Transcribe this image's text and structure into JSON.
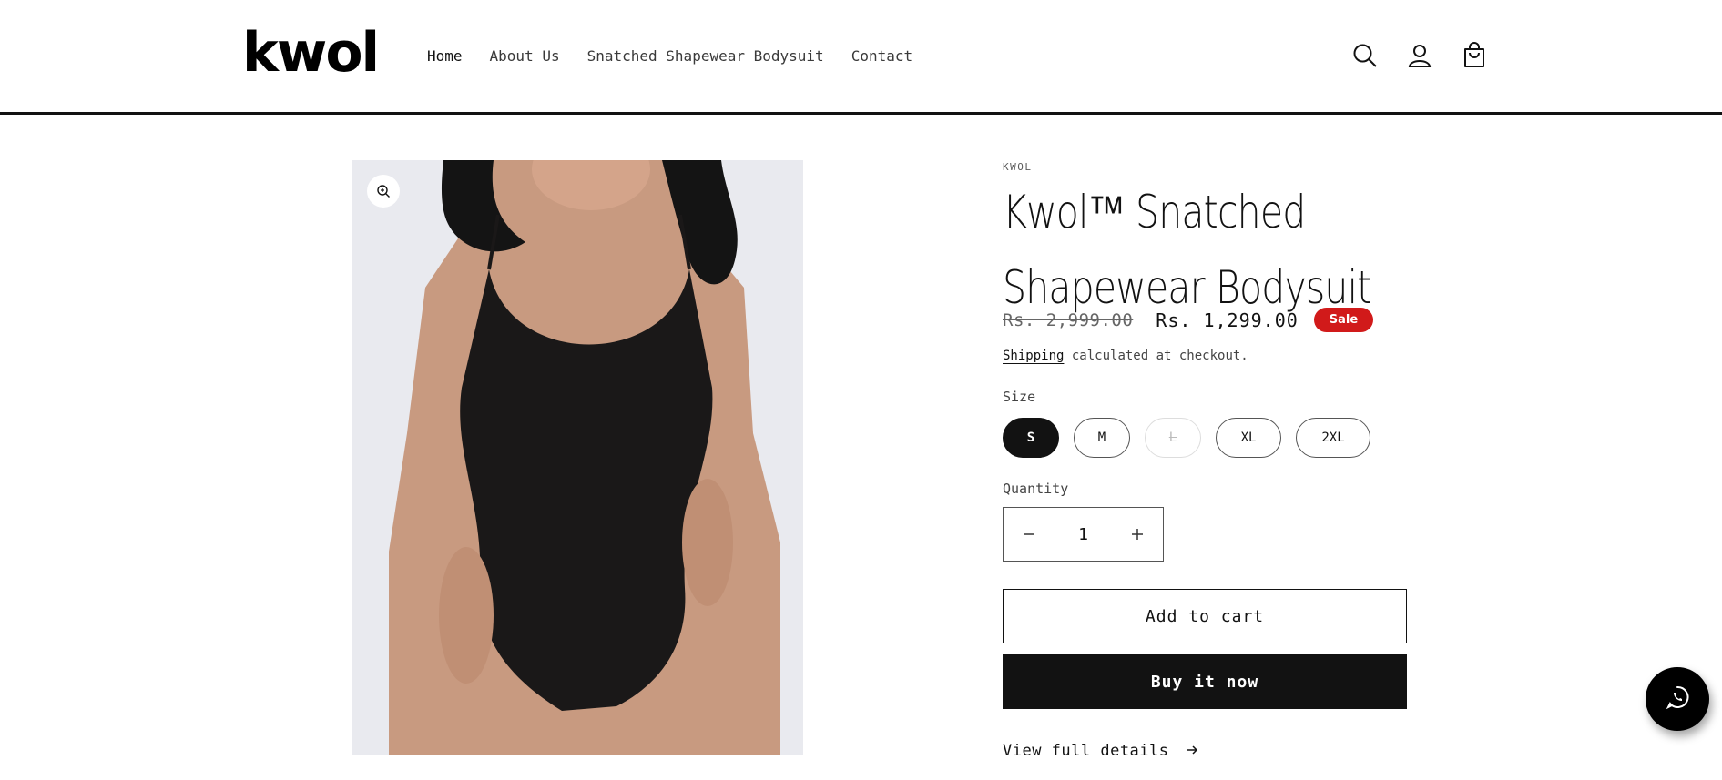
{
  "header": {
    "logo": "kwol",
    "nav": [
      "Home",
      "About Us",
      "Snatched Shapewear Bodysuit",
      "Contact"
    ],
    "icons": [
      "search-icon",
      "account-icon",
      "cart-icon"
    ]
  },
  "product": {
    "vendor": "KWOL",
    "title": "Kwol™ Snatched Shapewear Bodysuit",
    "price_regular": "Rs. 2,999.00",
    "price_sale": "Rs. 1,299.00",
    "badge": "Sale",
    "shipping_link": "Shipping",
    "shipping_text": " calculated at checkout.",
    "size_label": "Size",
    "sizes": [
      "S",
      "M",
      "L",
      "XL",
      "2XL"
    ],
    "selected_size": "S",
    "sold_out_size": "L",
    "quantity_label": "Quantity",
    "quantity": "1",
    "add_to_cart": "Add to cart",
    "buy_now": "Buy it now",
    "view_details": "View full details"
  },
  "colors": {
    "text": "#121212",
    "sale_badge": "#d11a1a",
    "image_bg": "#e9eaef"
  }
}
